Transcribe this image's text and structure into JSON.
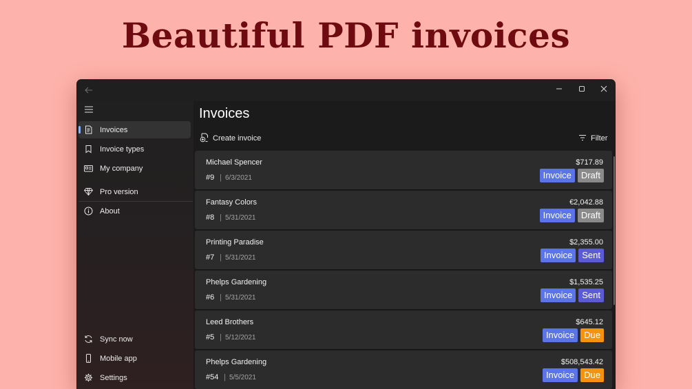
{
  "hero": {
    "title": "Beautiful PDF invoices"
  },
  "sidebar": {
    "items": [
      {
        "label": "Invoices",
        "icon": "invoice-icon",
        "selected": true
      },
      {
        "label": "Invoice types",
        "icon": "bookmark-icon",
        "selected": false
      },
      {
        "label": "My company",
        "icon": "id-card-icon",
        "selected": false
      },
      {
        "label": "Pro version",
        "icon": "diamond-icon",
        "selected": false
      },
      {
        "label": "About",
        "icon": "info-icon",
        "selected": false
      }
    ],
    "footer_items": [
      {
        "label": "Sync now",
        "icon": "sync-icon"
      },
      {
        "label": "Mobile app",
        "icon": "phone-icon"
      },
      {
        "label": "Settings",
        "icon": "gear-icon"
      }
    ],
    "accent_color": "#8fb2f0"
  },
  "main": {
    "title": "Invoices",
    "create_label": "Create invoice",
    "filter_label": "Filter"
  },
  "colors": {
    "invoice_tag": "#5b74e8",
    "draft_tag": "#8a8a8a",
    "sent_tag": "#5b5bd6",
    "due_tag": "#f5930f",
    "background": "#fdb3ab",
    "hero_title": "#6e0b10"
  },
  "invoices": [
    {
      "customer": "Michael Spencer",
      "number": "#9",
      "separator": "|",
      "date": "6/3/2021",
      "amount": "$717.89",
      "type_label": "Invoice",
      "status": "Draft"
    },
    {
      "customer": "Fantasy Colors",
      "number": "#8",
      "separator": "|",
      "date": "5/31/2021",
      "amount": "€2,042.88",
      "type_label": "Invoice",
      "status": "Draft"
    },
    {
      "customer": "Printing Paradise",
      "number": "#7",
      "separator": "|",
      "date": "5/31/2021",
      "amount": "$2,355.00",
      "type_label": "Invoice",
      "status": "Sent"
    },
    {
      "customer": "Phelps Gardening",
      "number": "#6",
      "separator": "|",
      "date": "5/31/2021",
      "amount": "$1,535.25",
      "type_label": "Invoice",
      "status": "Sent"
    },
    {
      "customer": "Leed Brothers",
      "number": "#5",
      "separator": "|",
      "date": "5/12/2021",
      "amount": "$645.12",
      "type_label": "Invoice",
      "status": "Due"
    },
    {
      "customer": "Phelps Gardening",
      "number": "#54",
      "separator": "|",
      "date": "5/5/2021",
      "amount": "$508,543.42",
      "type_label": "Invoice",
      "status": "Due"
    }
  ]
}
